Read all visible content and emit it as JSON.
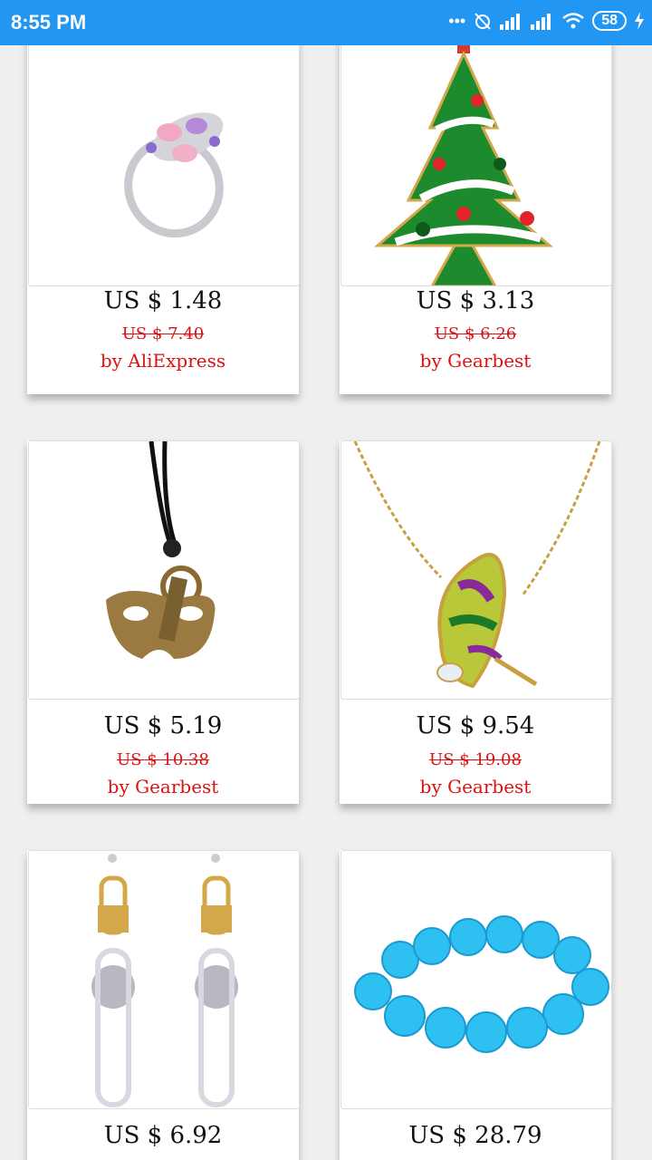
{
  "status_bar": {
    "time": "8:55 PM",
    "battery": "58"
  },
  "products": [
    {
      "price": "US $ 1.48",
      "original_price": "US $ 7.40",
      "seller": "by AliExpress",
      "image": "ring"
    },
    {
      "price": "US $ 3.13",
      "original_price": "US $ 6.26",
      "seller": "by Gearbest",
      "image": "christmas-tree-brooch"
    },
    {
      "price": "US $ 5.19",
      "original_price": "US $ 10.38",
      "seller": "by Gearbest",
      "image": "mask-pendant"
    },
    {
      "price": "US $ 9.54",
      "original_price": "US $ 19.08",
      "seller": "by Gearbest",
      "image": "butterfly-necklace"
    },
    {
      "price": "US $ 6.92",
      "image": "earrings"
    },
    {
      "price": "US $ 28.79",
      "image": "blue-bracelet"
    }
  ]
}
